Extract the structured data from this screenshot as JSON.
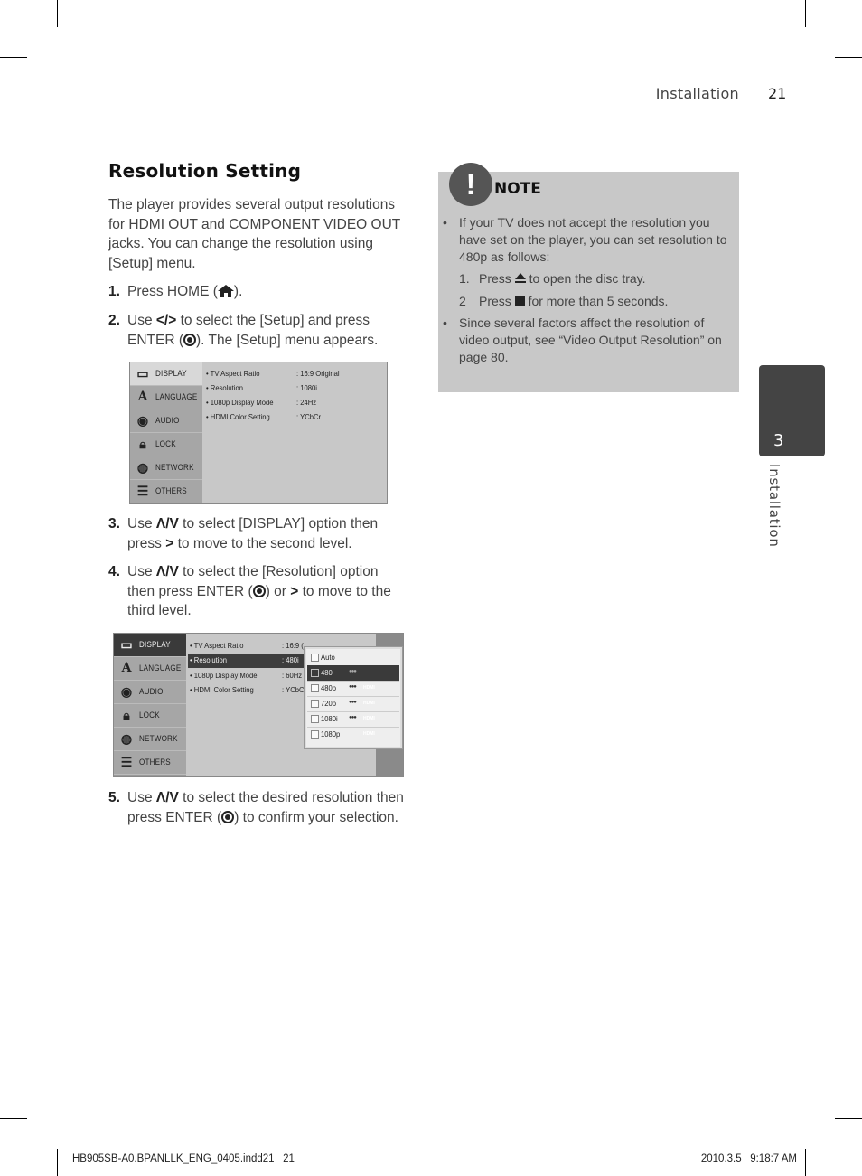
{
  "header": {
    "section": "Installation",
    "page_number": "21"
  },
  "title": "Resolution Setting",
  "intro": "The player provides several output resolutions for HDMI OUT and COMPONENT VIDEO OUT jacks. You can change the resolution using [Setup] menu.",
  "steps": [
    {
      "num": "1.",
      "pre": "Press HOME (",
      "icon": "home-icon",
      "post": ")."
    },
    {
      "num": "2.",
      "pre": "Use ",
      "sym": "</>",
      "mid": " to select the [Setup] and press ENTER (",
      "icon": "enter-icon",
      "post": "). The [Setup] menu appears."
    },
    {
      "num": "3.",
      "pre": "Use ",
      "sym": "Λ/V",
      "mid": " to select [DISPLAY] option then press ",
      "sym2": ">",
      "post": " to move to the second level."
    },
    {
      "num": "4.",
      "pre": "Use ",
      "sym": "Λ/V",
      "mid": " to select the [Resolution] option then press ENTER (",
      "icon": "enter-icon",
      "mid2": ") or ",
      "sym2": ">",
      "post": " to move to the third level."
    },
    {
      "num": "5.",
      "pre": "Use ",
      "sym": "Λ/V",
      "mid": " to select the desired resolution then press ENTER (",
      "icon": "enter-icon",
      "post": ") to confirm your selection."
    }
  ],
  "setup_menu_1": {
    "sidebar": [
      "DISPLAY",
      "LANGUAGE",
      "AUDIO",
      "LOCK",
      "NETWORK",
      "OTHERS"
    ],
    "selected": "DISPLAY",
    "options": [
      {
        "label": "• TV Aspect Ratio",
        "value": ": 16:9 Original"
      },
      {
        "label": "• Resolution",
        "value": ": 1080i"
      },
      {
        "label": "• 1080p Display Mode",
        "value": ": 24Hz"
      },
      {
        "label": "• HDMI Color Setting",
        "value": ": YCbCr"
      }
    ]
  },
  "setup_menu_2": {
    "sidebar": [
      "DISPLAY",
      "LANGUAGE",
      "AUDIO",
      "LOCK",
      "NETWORK",
      "OTHERS"
    ],
    "selected": "DISPLAY",
    "options": [
      {
        "label": "• TV Aspect Ratio",
        "value": ": 16:9 ("
      },
      {
        "label": "• Resolution",
        "value": ": 480i"
      },
      {
        "label": "• 1080p Display Mode",
        "value": ": 60Hz"
      },
      {
        "label": "• HDMI Color Setting",
        "value": ": YCbC"
      }
    ],
    "highlighted_option": "Resolution",
    "popup": [
      {
        "label": "Auto",
        "checked": false,
        "component": "",
        "hdmi": ""
      },
      {
        "label": "480i",
        "checked": true,
        "component": "●●●",
        "hdmi": ""
      },
      {
        "label": "480p",
        "checked": false,
        "component": "●●●",
        "hdmi": "HDMI"
      },
      {
        "label": "720p",
        "checked": false,
        "component": "●●●",
        "hdmi": "HDMI"
      },
      {
        "label": "1080i",
        "checked": false,
        "component": "●●●",
        "hdmi": "HDMI"
      },
      {
        "label": "1080p",
        "checked": false,
        "component": "",
        "hdmi": "HDMI"
      }
    ]
  },
  "note": {
    "title": "NOTE",
    "icon": "!",
    "bullet1": "If your TV does not accept the resolution you have set on the player, you can set resolution to 480p as follows:",
    "sub1_num": "1.",
    "sub1_pre": "Press ",
    "sub1_post": " to open the disc tray.",
    "sub2_num": "2",
    "sub2_pre": "Press ",
    "sub2_post": " for more than 5 seconds.",
    "bullet2": "Since several factors affect the resolution of video output, see “Video Output Resolution” on page 80.",
    "bullet_char": "•"
  },
  "chapter_tab": {
    "number": "3",
    "label": "Installation"
  },
  "footer": {
    "left": "HB905SB-A0.BPANLLK_ENG_0405.indd21   21",
    "right": "2010.3.5   9:18:7 AM"
  }
}
